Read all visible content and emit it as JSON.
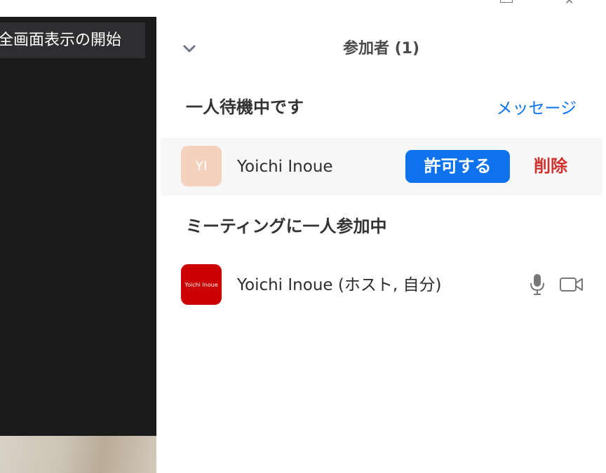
{
  "video": {
    "fullscreen_tip": "全画面表示の開始"
  },
  "window_controls": {
    "restore_icon": "restore-icon",
    "close_icon": "close-icon",
    "close_glyph": "✕"
  },
  "panel": {
    "title": "参加者 (1)",
    "collapse_icon": "chevron-down-icon"
  },
  "waiting_room": {
    "title": "一人待機中です",
    "message_label": "メッセージ",
    "participants": [
      {
        "initials": "YI",
        "name": "Yoichi Inoue",
        "admit_label": "許可する",
        "remove_label": "削除",
        "avatar_color": "#f5d2be"
      }
    ]
  },
  "in_meeting": {
    "title": "ミーティングに一人参加中",
    "participants": [
      {
        "avatar_text": "Yoichi Inoue",
        "name": "Yoichi Inoue (ホスト, 自分)",
        "avatar_color": "#cc0000",
        "icons": [
          "microphone-icon",
          "video-camera-icon"
        ]
      }
    ]
  },
  "colors": {
    "accent": "#0e72ed",
    "danger": "#d0312d",
    "video_bg": "#1b1b1b"
  }
}
